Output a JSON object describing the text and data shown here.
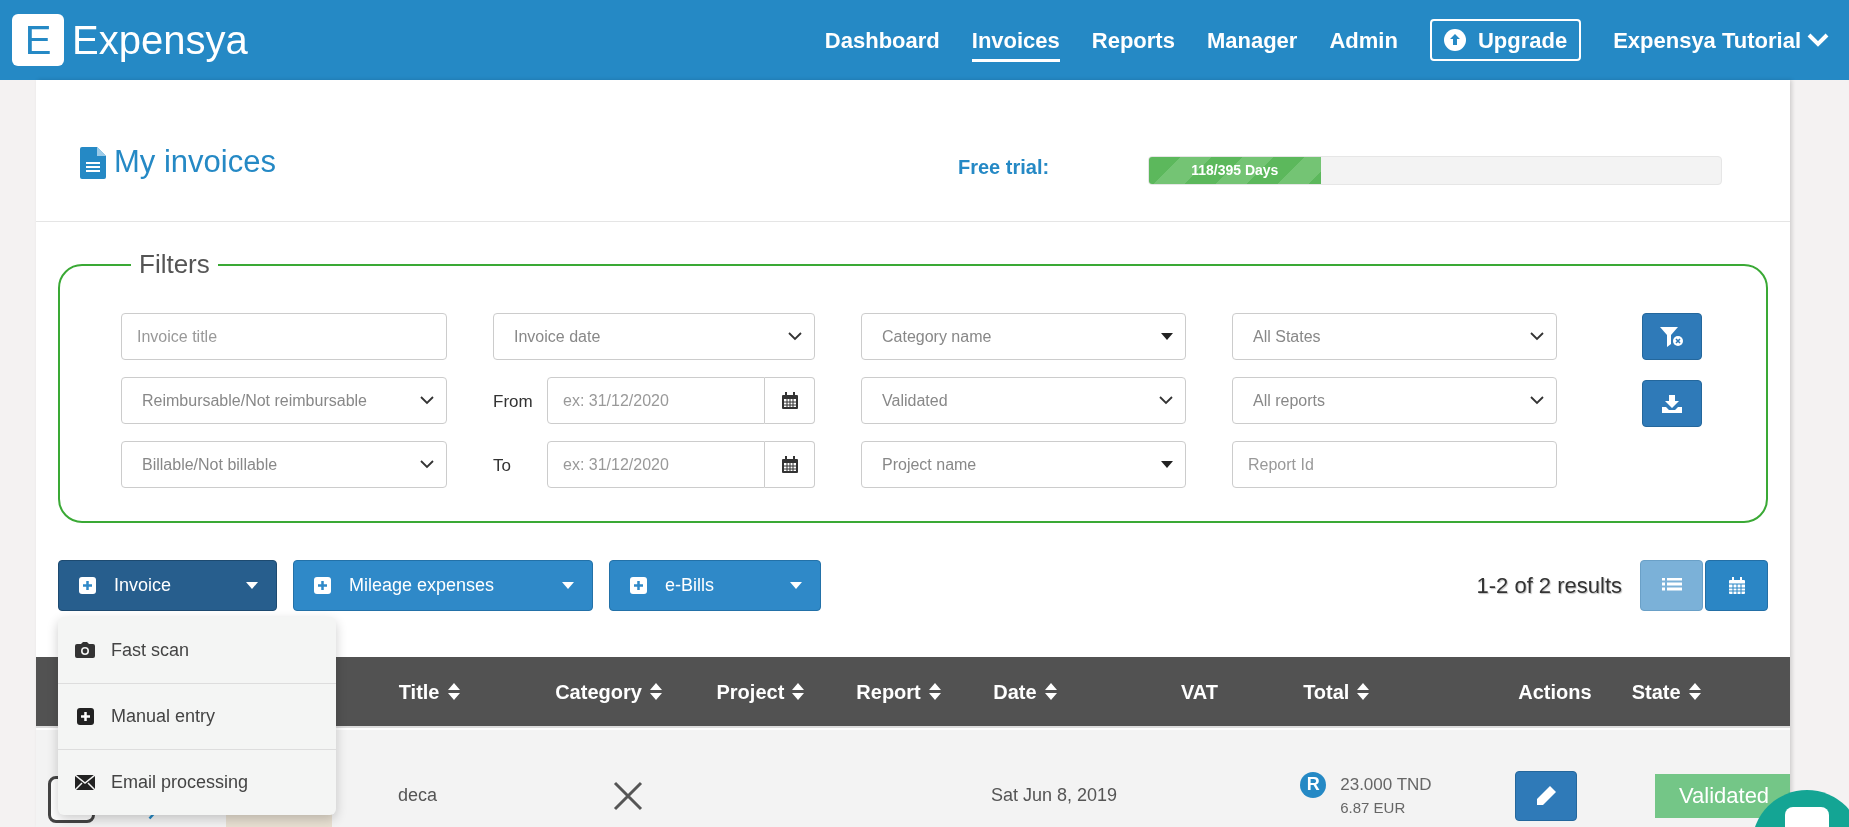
{
  "header": {
    "logo_mark": "E",
    "logo_text": "Expensya",
    "nav": [
      {
        "label": "Dashboard",
        "selected": false
      },
      {
        "label": "Invoices",
        "selected": true
      },
      {
        "label": "Reports",
        "selected": false
      },
      {
        "label": "Manager",
        "selected": false
      },
      {
        "label": "Admin",
        "selected": false
      }
    ],
    "upgrade": "Upgrade",
    "user_menu": "Expensya Tutorial"
  },
  "page_title": "My invoices",
  "trial": {
    "label": "Free trial:",
    "text": "118/395 Days",
    "level": 0.3
  },
  "filters": {
    "legend": "Filters",
    "rows": [
      [
        {
          "kind": "text",
          "placeholder": "Invoice title"
        },
        {
          "kind": "select",
          "value": "Invoice date"
        },
        {
          "kind": "combo",
          "value": "Category name"
        },
        {
          "kind": "select",
          "value": "All States"
        }
      ],
      [
        {
          "kind": "select",
          "value": "Reimbursable/Not reimbursable"
        },
        {
          "kind": "date",
          "label": "From",
          "placeholder": "ex: 31/12/2020"
        },
        {
          "kind": "select",
          "value": "Validated"
        },
        {
          "kind": "select",
          "value": "All reports"
        }
      ],
      [
        {
          "kind": "select",
          "value": "Billable/Not billable"
        },
        {
          "kind": "date",
          "label": "To",
          "placeholder": "ex: 31/12/2020"
        },
        {
          "kind": "combo",
          "value": "Project name"
        },
        {
          "kind": "text",
          "placeholder": "Report Id"
        }
      ]
    ]
  },
  "add_buttons": [
    {
      "label": "Invoice",
      "selected": true
    },
    {
      "label": "Mileage expenses",
      "selected": false
    },
    {
      "label": "e-Bills",
      "selected": false
    }
  ],
  "add_menu": [
    {
      "label": "Fast scan"
    },
    {
      "label": "Manual entry"
    },
    {
      "label": "Email processing"
    }
  ],
  "results": "1-2 of 2 results",
  "views": [
    {
      "kind": "list",
      "selected": true
    },
    {
      "kind": "calendar",
      "selected": false
    }
  ],
  "table": {
    "columns": [
      {
        "label": "Title",
        "sortable": true
      },
      {
        "label": "Category",
        "sortable": true
      },
      {
        "label": "Project",
        "sortable": true
      },
      {
        "label": "Report",
        "sortable": true
      },
      {
        "label": "Date",
        "sortable": true
      },
      {
        "label": "VAT",
        "sortable": false
      },
      {
        "label": "Total",
        "sortable": true
      },
      {
        "label": "Actions",
        "sortable": false
      },
      {
        "label": "State",
        "sortable": true
      }
    ],
    "rows": [
      {
        "checked": false,
        "title": "deca",
        "date": "Sat Jun 8, 2019",
        "receipt_badge": "R",
        "total": "23.000 TND",
        "total_converted": "6.87 EUR",
        "state": "Validated"
      }
    ]
  }
}
